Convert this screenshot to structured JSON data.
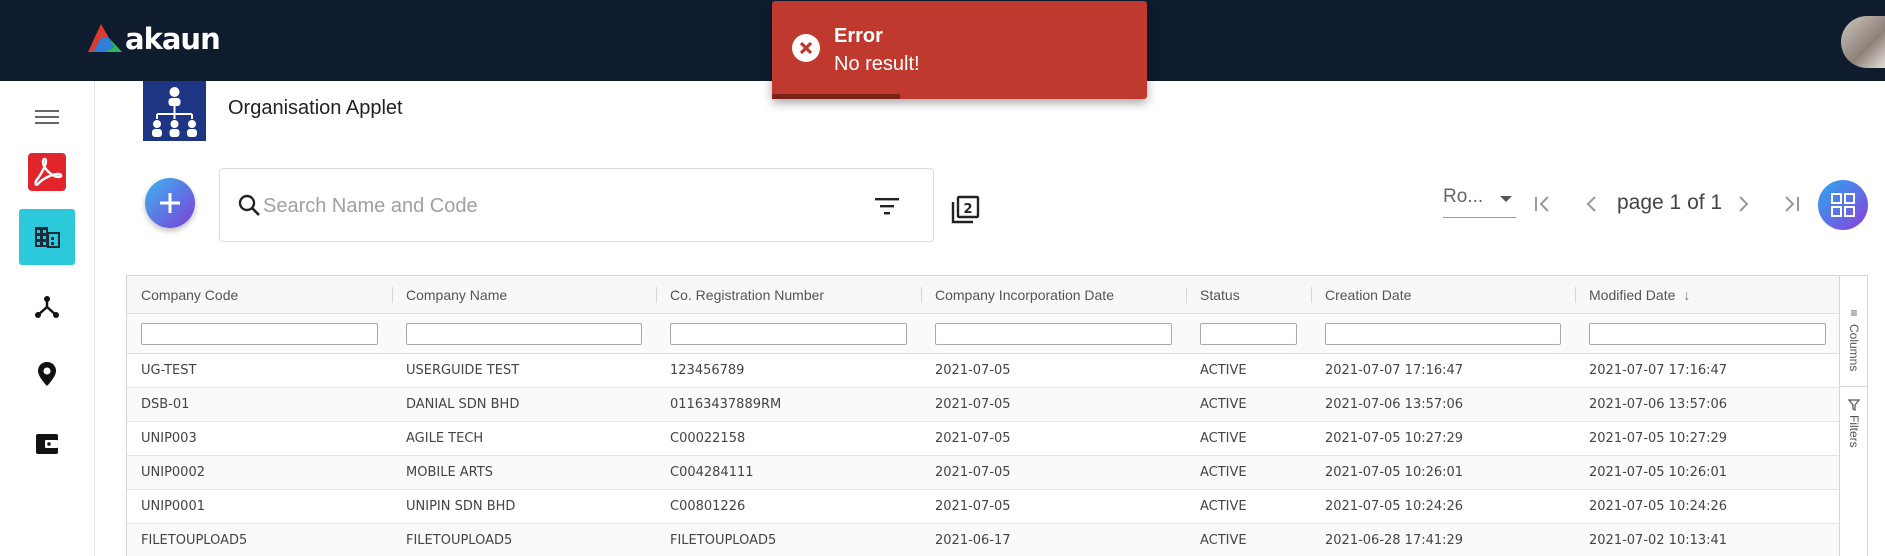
{
  "app": {
    "logo_text": "akaun"
  },
  "applet": {
    "title": "Organisation Applet"
  },
  "search": {
    "placeholder": "Search Name and Code",
    "value": ""
  },
  "toolbar": {
    "compare_count": "2"
  },
  "pagination": {
    "rows_label": "Ro...",
    "page_label": "page 1 of 1"
  },
  "toast": {
    "title": "Error",
    "message": "No result!",
    "progress": 0.34,
    "color": "#c0392f"
  },
  "colors": {
    "topbar": "#0f1c2e",
    "accent": "#2cc9db",
    "applet_icon_bg": "#1e3583"
  },
  "table": {
    "columns": [
      "Company Code",
      "Company Name",
      "Co. Registration Number",
      "Company Incorporation Date",
      "Status",
      "Creation Date",
      "Modified Date"
    ],
    "sorted_column": "Modified Date",
    "sort_direction": "descending",
    "rows": [
      [
        "UG-TEST",
        "USERGUIDE TEST",
        "123456789",
        "2021-07-05",
        "ACTIVE",
        "2021-07-07 17:16:47",
        "2021-07-07 17:16:47"
      ],
      [
        "DSB-01",
        "DANIAL SDN BHD",
        "01163437889RM",
        "2021-07-05",
        "ACTIVE",
        "2021-07-06 13:57:06",
        "2021-07-06 13:57:06"
      ],
      [
        "UNIP003",
        "AGILE TECH",
        "C00022158",
        "2021-07-05",
        "ACTIVE",
        "2021-07-05 10:27:29",
        "2021-07-05 10:27:29"
      ],
      [
        "UNIP0002",
        "MOBILE ARTS",
        "C004284111",
        "2021-07-05",
        "ACTIVE",
        "2021-07-05 10:26:01",
        "2021-07-05 10:26:01"
      ],
      [
        "UNIP0001",
        "UNIPIN SDN BHD",
        "C00801226",
        "2021-07-05",
        "ACTIVE",
        "2021-07-05 10:24:26",
        "2021-07-05 10:24:26"
      ],
      [
        "FILETOUPLOAD5",
        "FILETOUPLOAD5",
        "FILETOUPLOAD5",
        "2021-06-17",
        "ACTIVE",
        "2021-06-28 17:41:29",
        "2021-07-02 10:13:41"
      ]
    ],
    "side_tools": {
      "columns_label": "Columns",
      "filters_label": "Filters"
    }
  },
  "sidebar": {
    "items": [
      {
        "icon": "menu-icon"
      },
      {
        "icon": "adobe-acrobat-icon"
      },
      {
        "icon": "building-icon",
        "active": true
      },
      {
        "icon": "hierarchy-icon"
      },
      {
        "icon": "location-pin-icon"
      },
      {
        "icon": "wallet-icon"
      }
    ]
  }
}
